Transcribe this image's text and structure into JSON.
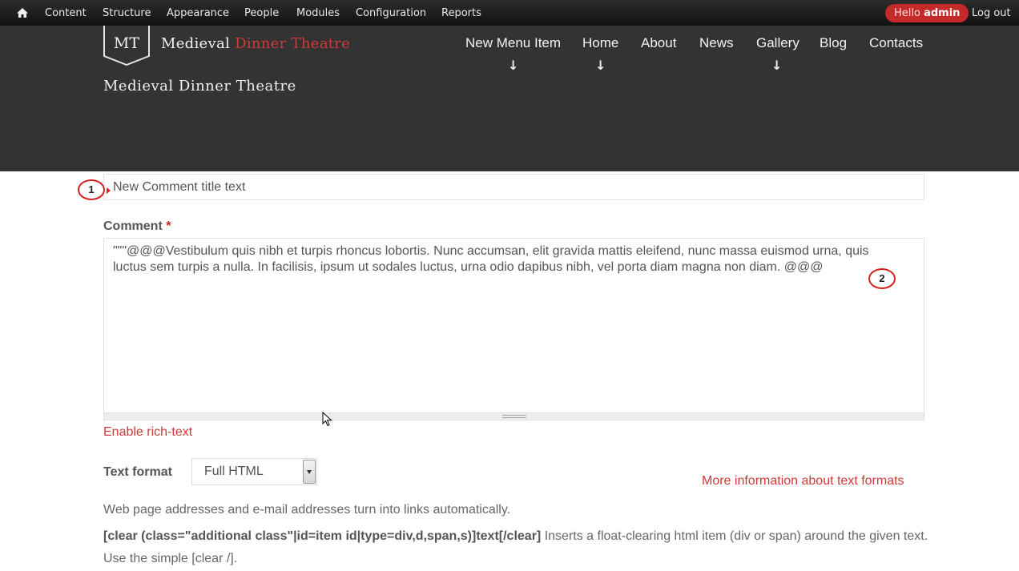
{
  "toolbar": {
    "home_icon": "home-icon",
    "items": [
      "Content",
      "Structure",
      "Appearance",
      "People",
      "Modules",
      "Configuration",
      "Reports"
    ],
    "hello_prefix": "Hello",
    "hello_user": "admin",
    "logout": "Log out",
    "accent": "#c52a2a"
  },
  "header": {
    "logo_badge": "MT",
    "logo_word1": "Medieval",
    "logo_word2": "Dinner Theatre",
    "site_name": "Medieval Dinner Theatre",
    "nav": [
      {
        "label": "New Menu Item",
        "has_children": true
      },
      {
        "label": "Home",
        "has_children": true
      },
      {
        "label": "About",
        "has_children": false
      },
      {
        "label": "News",
        "has_children": false
      },
      {
        "label": "Gallery",
        "has_children": true
      },
      {
        "label": "Blog",
        "has_children": false
      },
      {
        "label": "Contacts",
        "has_children": false
      }
    ],
    "arrow_glyph": "↓",
    "background": "#333333"
  },
  "form": {
    "title_value": "New Comment title text",
    "comment_label": "Comment",
    "required_mark": "*",
    "comment_value_line1": "\"\"\"@@@Vestibulum quis nibh et turpis rhoncus lobortis. Nunc accumsan, elit gravida mattis eleifend, nunc massa euismod urna, quis",
    "comment_value_line2": "luctus sem turpis a nulla. In facilisis, ipsum ut sodales luctus, urna odio dapibus nibh, vel porta diam magna non diam. @@@",
    "enable_rich_text": "Enable rich-text",
    "text_format_label": "Text format",
    "text_format_value": "Full HTML",
    "more_info": "More information about text formats",
    "tip_1": "Web page addresses and e-mail addresses turn into links automatically.",
    "tip_2_code": "[clear (class=\"additional class\"|id=item id|type=div,d,span,s)]text[/clear]",
    "tip_2_text": " Inserts a float-clearing html item (div or span) around the given text. Use the simple [clear /].",
    "link_color": "#d03a3a"
  },
  "annotations": {
    "marker_1": "1",
    "marker_2": "2",
    "marker_color": "#d62020"
  }
}
